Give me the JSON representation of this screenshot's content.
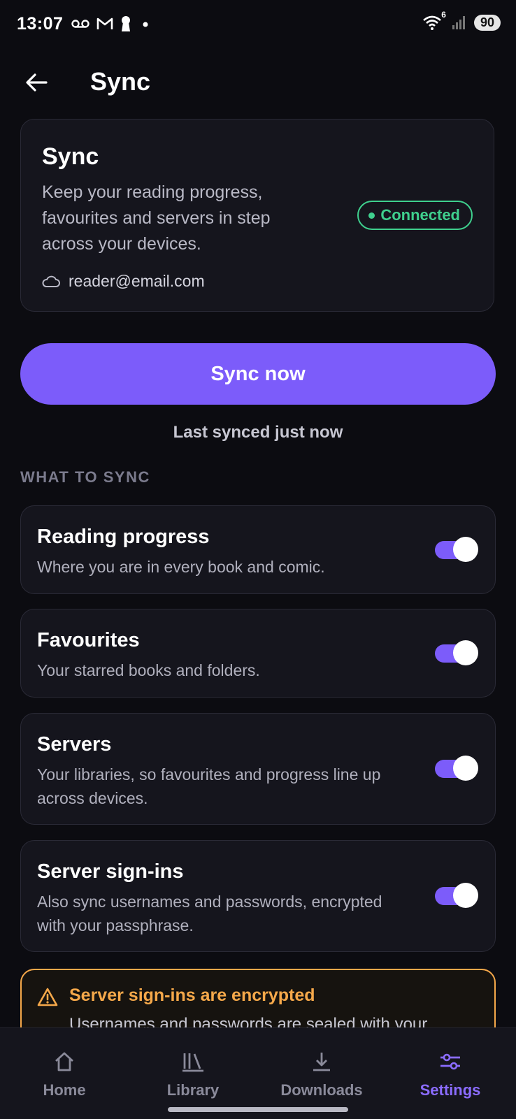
{
  "status_bar": {
    "time": "13:07",
    "left_icons": [
      "voicemail-icon",
      "gmail-icon",
      "keyhole-icon",
      "dot-icon"
    ],
    "wifi_badge": "6",
    "battery": "90"
  },
  "header": {
    "back_icon": "arrow-left-icon",
    "title": "Sync"
  },
  "account_card": {
    "title": "Sync",
    "description": "Keep your reading progress, favourites and servers in step across your devices.",
    "status": "Connected",
    "status_color": "#3fd08e",
    "account_icon": "cloud-icon",
    "email": "reader@email.com"
  },
  "actions": {
    "sync_now": "Sync now",
    "last_synced": "Last synced just now"
  },
  "what_to_sync": {
    "label": "WHAT TO SYNC",
    "items": [
      {
        "title": "Reading progress",
        "description": "Where you are in every book and comic.",
        "enabled": true
      },
      {
        "title": "Favourites",
        "description": "Your starred books and folders.",
        "enabled": true
      },
      {
        "title": "Servers",
        "description": "Your libraries, so favourites and progress line up across devices.",
        "enabled": true
      },
      {
        "title": "Server sign-ins",
        "description": "Also sync usernames and passwords, encrypted with your passphrase.",
        "enabled": true
      }
    ]
  },
  "warning": {
    "icon": "warning-triangle-icon",
    "title": "Server sign-ins are encrypted",
    "text": "Usernames and passwords are sealed with your"
  },
  "bottom_nav": {
    "items": [
      {
        "label": "Home",
        "icon": "home-icon",
        "active": false
      },
      {
        "label": "Library",
        "icon": "library-icon",
        "active": false
      },
      {
        "label": "Downloads",
        "icon": "download-icon",
        "active": false
      },
      {
        "label": "Settings",
        "icon": "sliders-icon",
        "active": true
      }
    ]
  },
  "colors": {
    "accent": "#7c5cfa",
    "background": "#0c0c11",
    "card": "#15151d",
    "warning": "#f5a84a"
  }
}
